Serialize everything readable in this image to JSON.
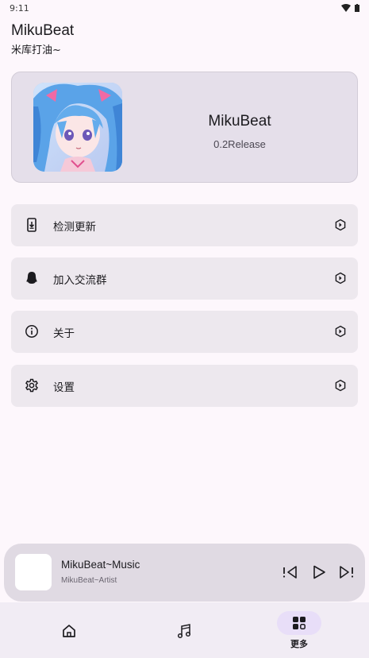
{
  "status_bar": {
    "time": "9:11"
  },
  "app": {
    "title": "MikuBeat",
    "subtitle": "米库打油~"
  },
  "hero": {
    "name": "MikuBeat",
    "version": "0.2Release"
  },
  "menu": [
    {
      "label": "检测更新",
      "icon": "phone-download-icon"
    },
    {
      "label": "加入交流群",
      "icon": "qq-penguin-icon"
    },
    {
      "label": "关于",
      "icon": "info-icon"
    },
    {
      "label": "设置",
      "icon": "gear-icon"
    }
  ],
  "player": {
    "title": "MikuBeat~Music",
    "artist": "MikuBeat~Artist"
  },
  "nav": {
    "more_label": "更多"
  },
  "colors": {
    "background": "#fdf7fc",
    "card": "#ede8ee",
    "hero": "#e5dfea",
    "player": "#e0dae3",
    "nav": "#f1ecf4",
    "active_pill": "#e8def8"
  }
}
